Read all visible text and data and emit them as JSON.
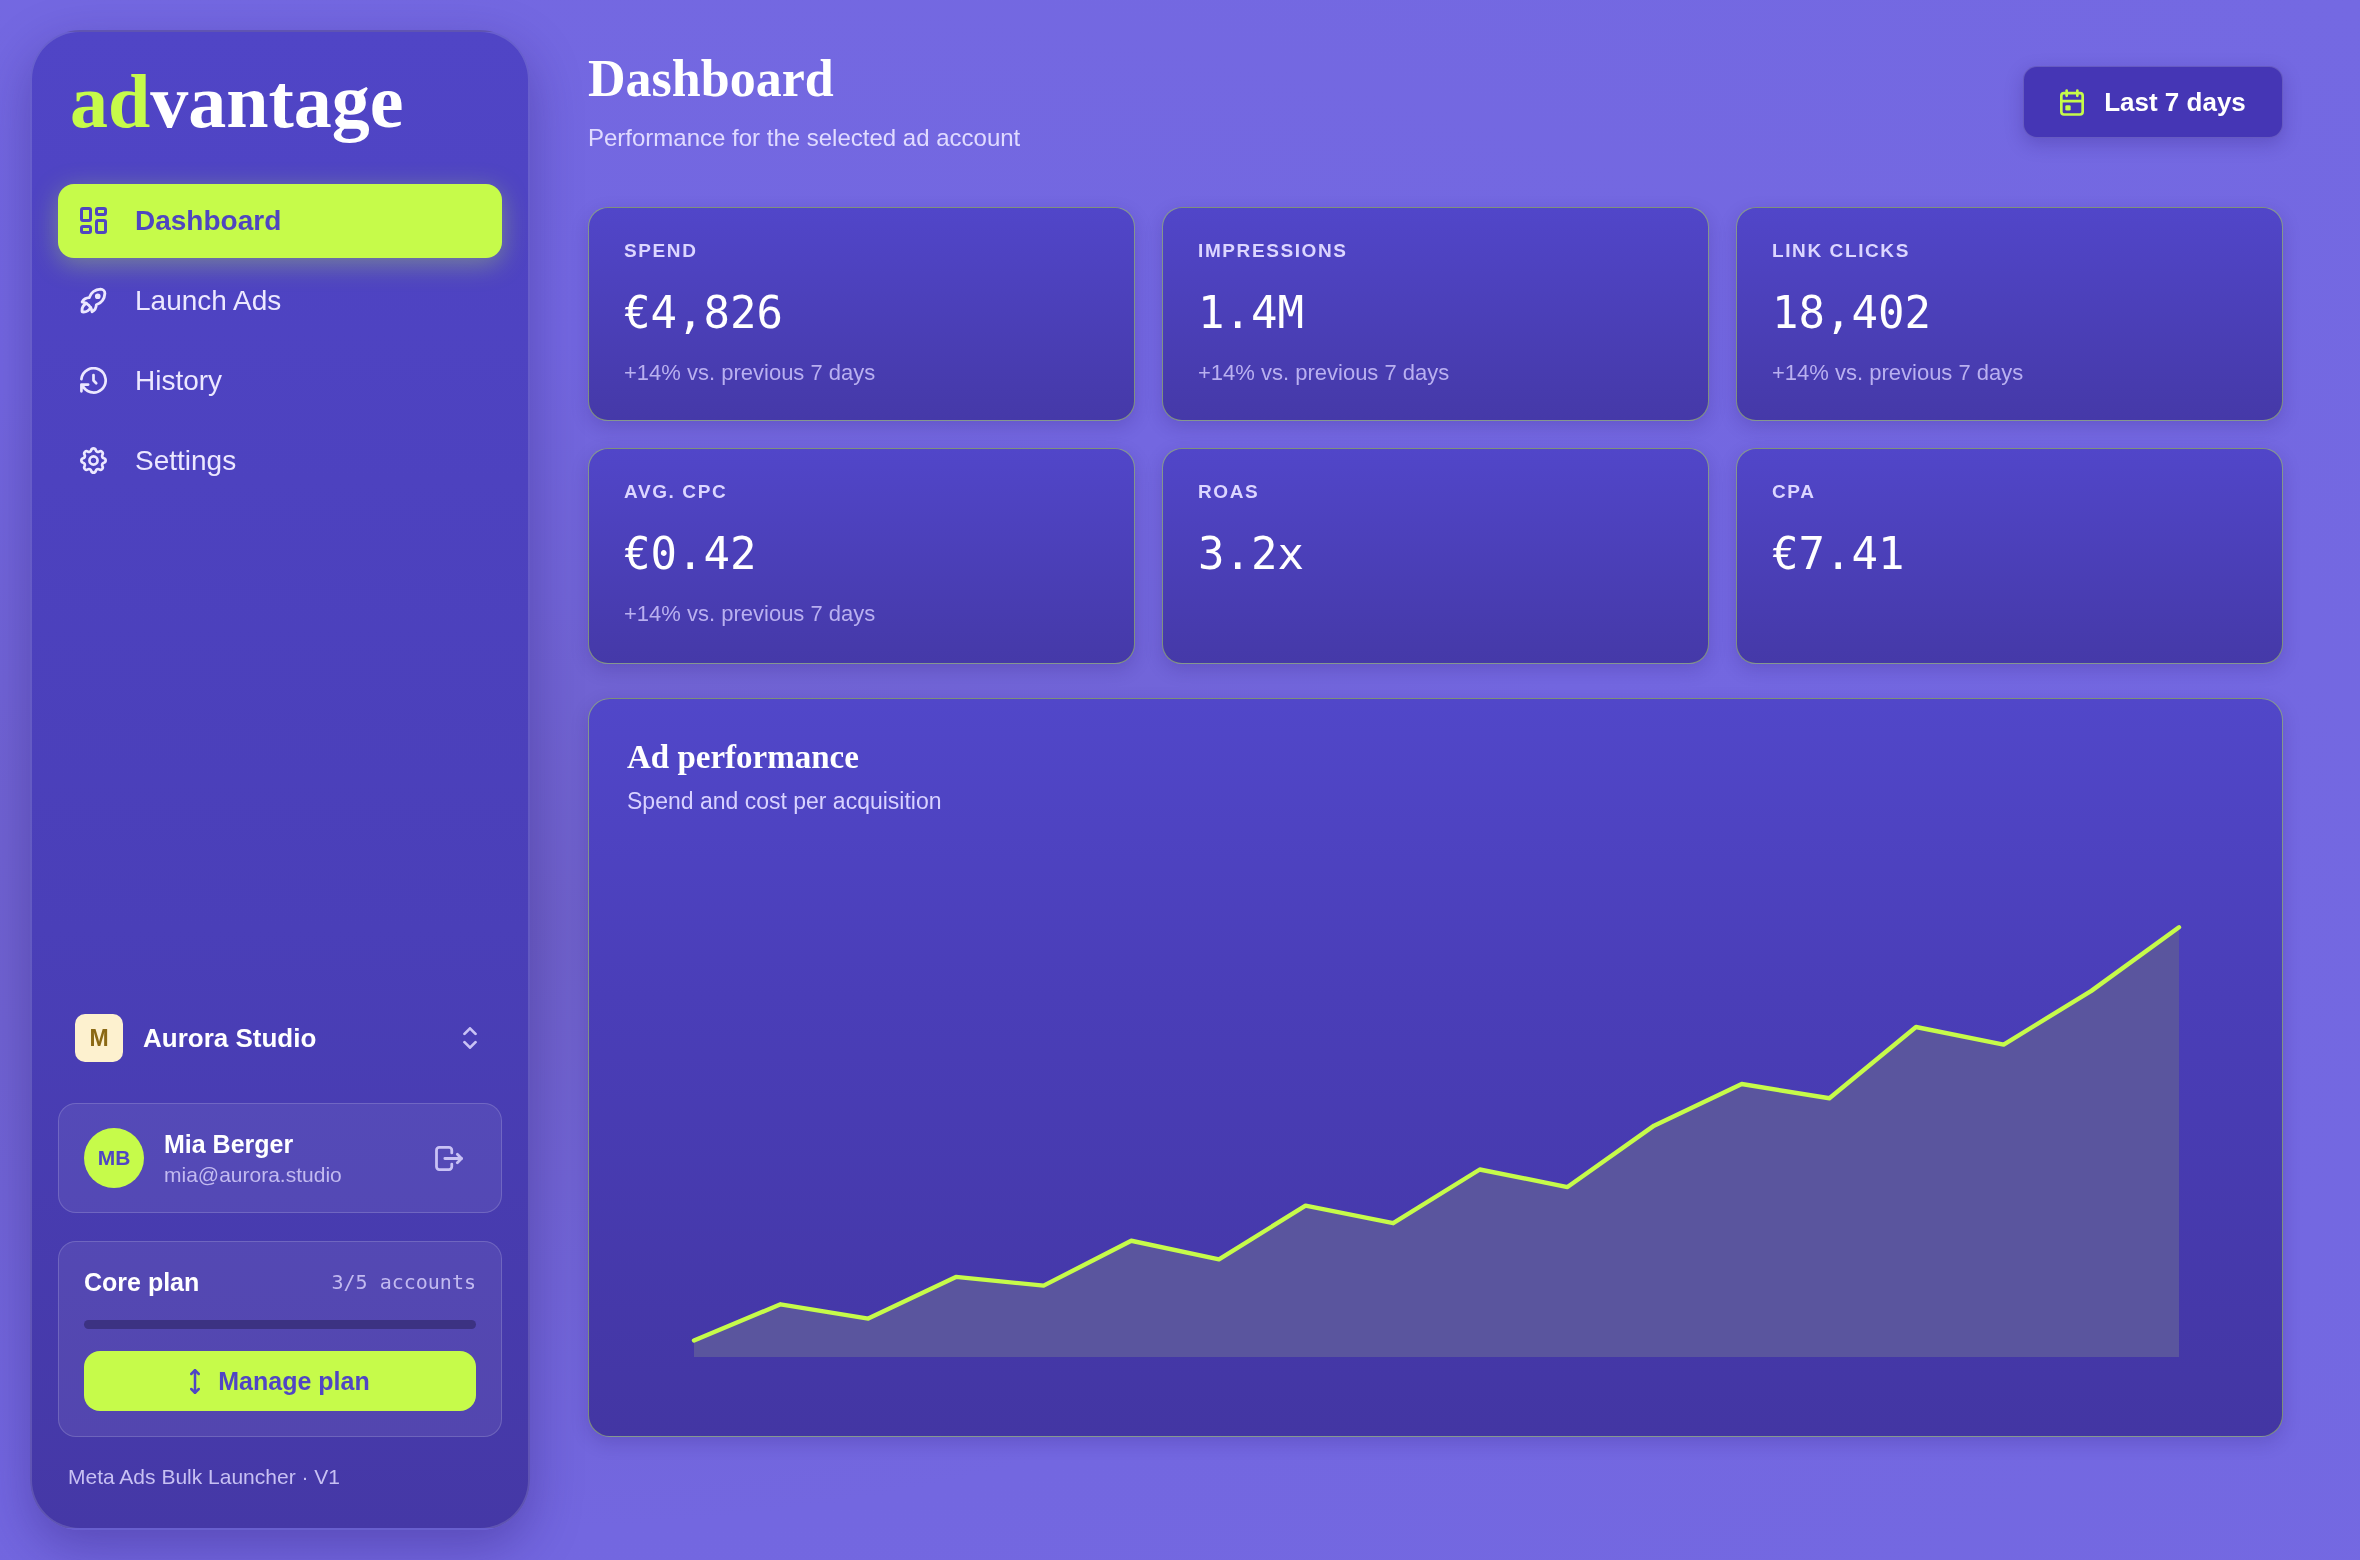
{
  "sidebar": {
    "logo": {
      "accent": "ad",
      "rest": "vantage"
    },
    "nav": [
      {
        "label": "Dashboard",
        "selected": true
      },
      {
        "label": "Launch Ads",
        "selected": false
      },
      {
        "label": "History",
        "selected": false
      },
      {
        "label": "Settings",
        "selected": false
      }
    ],
    "account": {
      "initial": "M",
      "name": "Aurora Studio"
    },
    "user": {
      "initials": "MB",
      "name": "Mia Berger",
      "email": "mia@aurora.studio"
    },
    "plan": {
      "name": "Core plan",
      "usage": "3/5 accounts",
      "level": 0,
      "button": "Manage plan"
    },
    "footer": "Meta Ads Bulk Launcher · V1"
  },
  "header": {
    "title": "Dashboard",
    "subtitle": "Performance for the selected ad account",
    "date_range": "Last 7 days"
  },
  "stats": [
    {
      "label": "SPEND",
      "value": "€4,826",
      "change": "+14% vs. previous 7 days"
    },
    {
      "label": "IMPRESSIONS",
      "value": "1.4M",
      "change": "+14% vs. previous 7 days"
    },
    {
      "label": "LINK CLICKS",
      "value": "18,402",
      "change": "+14% vs. previous 7 days"
    },
    {
      "label": "AVG. CPC",
      "value": "€0.42",
      "change": "+14% vs. previous 7 days"
    },
    {
      "label": "ROAS",
      "value": "3.2x"
    },
    {
      "label": "CPA",
      "value": "€7.41"
    }
  ],
  "chart_card": {
    "title": "Ad performance",
    "subtitle": "Spend and cost per acquisition"
  }
}
